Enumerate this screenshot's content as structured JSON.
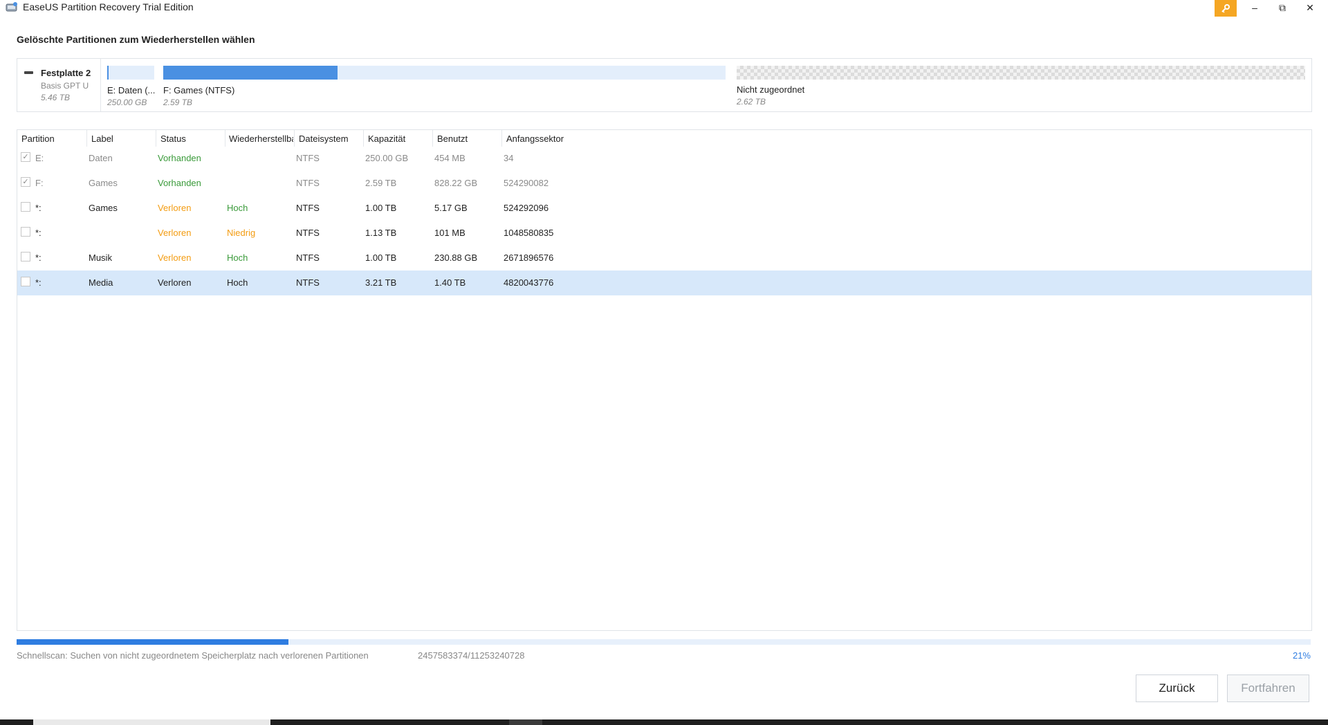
{
  "window": {
    "title": "EaseUS Partition Recovery Trial Edition",
    "key_icon": "key-icon",
    "controls": [
      "minimize-icon",
      "restore-icon",
      "close-icon"
    ],
    "minimize_glyph": "–",
    "restore_glyph": "⧉",
    "close_glyph": "✕",
    "accent_color": "#f5a623"
  },
  "heading": "Gelöschte Partitionen zum Wiederherstellen wählen",
  "disk": {
    "name": "Festplatte 2",
    "type": "Basis GPT U",
    "size": "5.46 TB",
    "segments": [
      {
        "label": "E: Daten (...",
        "size": "250.00 GB",
        "used_fraction": 0.0
      },
      {
        "label": "F: Games (NTFS)",
        "size": "2.59 TB",
        "used_fraction": 0.31
      },
      {
        "label": "Nicht zugeordnet",
        "size": "2.62 TB"
      }
    ]
  },
  "table": {
    "columns": [
      "Partition",
      "Label",
      "Status",
      "Wiederherstellbarkeit",
      "Dateisystem",
      "Kapazität",
      "Benutzt",
      "Anfangssektor"
    ],
    "rows": [
      {
        "checked": true,
        "partition": "E:",
        "label": "Daten",
        "status": "Vorhanden",
        "recoverability": "",
        "filesystem": "NTFS",
        "capacity": "250.00 GB",
        "used": "454 MB",
        "start_sector": "34"
      },
      {
        "checked": true,
        "partition": "F:",
        "label": "Games",
        "status": "Vorhanden",
        "recoverability": "",
        "filesystem": "NTFS",
        "capacity": "2.59 TB",
        "used": "828.22 GB",
        "start_sector": "524290082"
      },
      {
        "checked": false,
        "partition": "*:",
        "label": "Games",
        "status": "Verloren",
        "recoverability": "Hoch",
        "filesystem": "NTFS",
        "capacity": "1.00 TB",
        "used": "5.17 GB",
        "start_sector": "524292096"
      },
      {
        "checked": false,
        "partition": "*:",
        "label": "",
        "status": "Verloren",
        "recoverability": "Niedrig",
        "filesystem": "NTFS",
        "capacity": "1.13 TB",
        "used": "101 MB",
        "start_sector": "1048580835"
      },
      {
        "checked": false,
        "partition": "*:",
        "label": "Musik",
        "status": "Verloren",
        "recoverability": "Hoch",
        "filesystem": "NTFS",
        "capacity": "1.00 TB",
        "used": "230.88 GB",
        "start_sector": "2671896576"
      },
      {
        "checked": false,
        "partition": "*:",
        "label": "Media",
        "status": "Verloren",
        "recoverability": "Hoch",
        "filesystem": "NTFS",
        "capacity": "3.21 TB",
        "used": "1.40 TB",
        "start_sector": "4820043776",
        "selected": true
      }
    ],
    "status_colors": {
      "existing": "#3a9a3a",
      "lost": "#f39c12",
      "high": "#3a9a3a",
      "low": "#f39c12"
    }
  },
  "scan": {
    "status_text": "Schnellscan: Suchen von nicht zugeordnetem Speicherplatz nach verlorenen Partitionen",
    "sector_progress": "2457583374/11253240728",
    "percent_text": "21%",
    "progress": 0.21
  },
  "buttons": {
    "back": "Zurück",
    "next": "Fortfahren"
  }
}
